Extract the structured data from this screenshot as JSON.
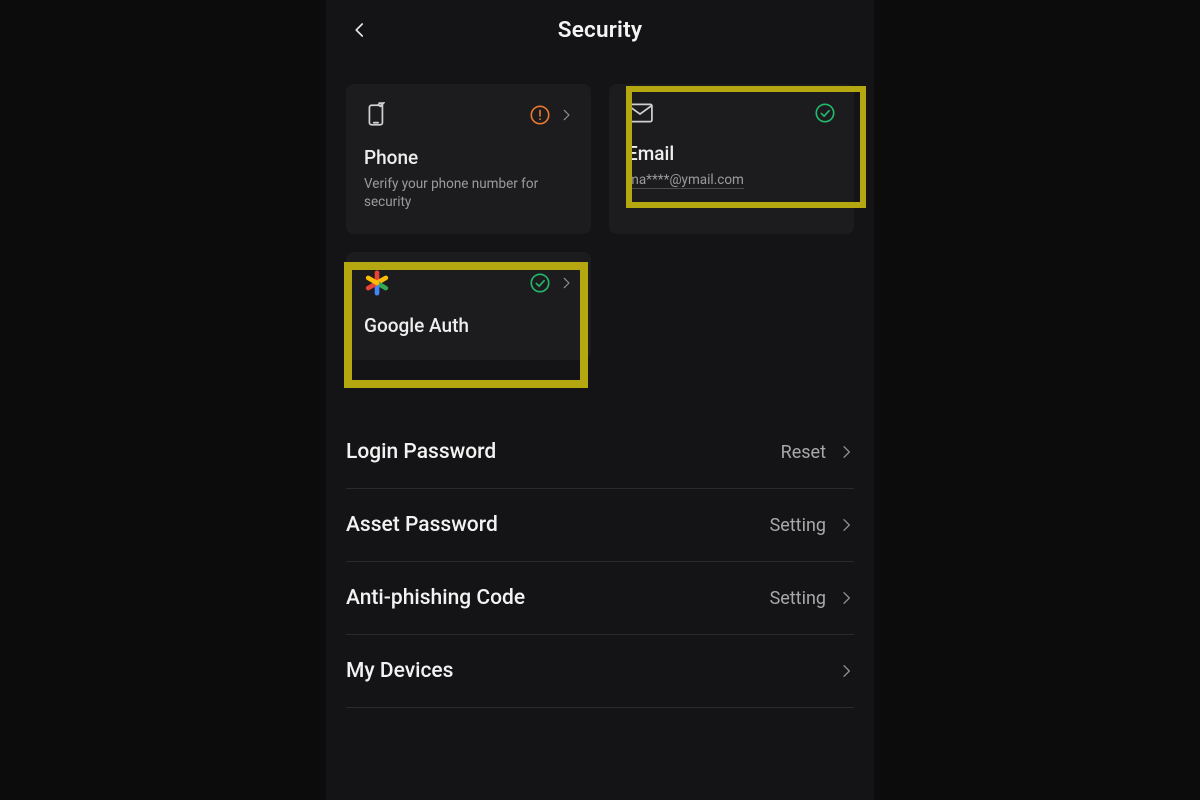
{
  "header": {
    "title": "Security"
  },
  "cards": {
    "phone": {
      "title": "Phone",
      "subtitle": "Verify your phone number for security"
    },
    "email": {
      "title": "Email",
      "value": "ma****@ymail.com"
    },
    "google_auth": {
      "title": "Google Auth"
    }
  },
  "rows": {
    "login_password": {
      "label": "Login Password",
      "action": "Reset"
    },
    "asset_password": {
      "label": "Asset Password",
      "action": "Setting"
    },
    "anti_phishing": {
      "label": "Anti-phishing Code",
      "action": "Setting"
    },
    "my_devices": {
      "label": "My Devices",
      "action": ""
    }
  },
  "colors": {
    "warn": "#e9772d",
    "ok": "#23b86b",
    "highlight": "#b4a70f"
  }
}
